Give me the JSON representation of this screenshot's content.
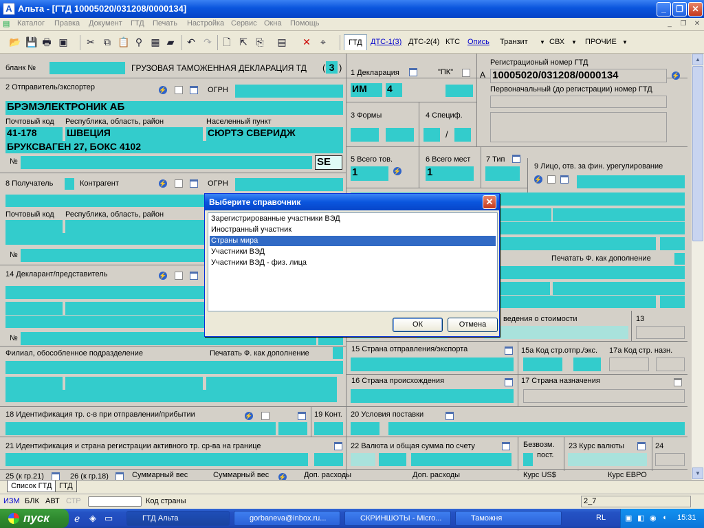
{
  "window": {
    "title": "Альта - [ГТД 10005020/031208/0000134]",
    "app_icon": "A"
  },
  "menu": [
    "Каталог",
    "Правка",
    "Документ",
    "ГТД",
    "Печать",
    "Настройка",
    "Сервис",
    "Окна",
    "Помощь"
  ],
  "doc_tabs": {
    "gtd": "ГТД",
    "dts1": "ДТС-1(3)",
    "dts2": "ДТС-2(4)",
    "kts": "КТС",
    "opis": "Опись",
    "tranzit": "Транзит",
    "svh": "СВХ",
    "prochie": "ПРОЧИЕ"
  },
  "form": {
    "blank_label": "бланк №",
    "doc_title": "ГРУЗОВАЯ ТАМОЖЕННАЯ ДЕКЛАРАЦИЯ  ТД",
    "doc_num": "3",
    "s1_label": "1 Декларация",
    "pk_label": "\"ПК\"",
    "s1_v1": "ИМ",
    "s1_v2": "4",
    "a_label": "А",
    "reg_label": "Регистрационый номер ГТД",
    "reg_num": "10005020/031208/0000134",
    "reg_initial_label": "Первоначальный (до регистрации) номер ГТД",
    "s2_label": "2 Отправитель/экспортер",
    "ogrn": "ОГРН",
    "sender_name": "БРЭМЭЛЕКТРОНИК АБ",
    "postal_label": "Почтовый код",
    "region_label": "Республика, область, район",
    "city_label": "Населенный пункт",
    "postal": "41-178",
    "region": "ШВЕЦИЯ",
    "city": "СЮРТЭ СВЕРИДЖ",
    "street": "БРУКСВАГЕН 27, БОКС 4102",
    "num_label": "№",
    "country_code": "SE",
    "s3_label": "3 Формы",
    "s4_label": "4 Специф.",
    "slash": "/",
    "s5_label": "5 Всего тов.",
    "s5_val": "1",
    "s6_label": "6 Всего мест",
    "s6_val": "1",
    "s7_label": "7 Тип",
    "s8_label": "8 Получатель",
    "kontragent": "Контрагент",
    "s9_label": "9 Лицо, отв. за фин. урегулирование",
    "print_f_addition": "Печатать Ф. как дополнение",
    "s14_label": "14 Декларант/представитель",
    "s12_label": "ведения о стоимости",
    "s13_label": "13",
    "filial_label": "Филиал, обособленное подразделение",
    "s15_label": "15 Страна отправления/экспорта",
    "s15a_label": "15а Код стр.отпр./экс.",
    "s17a_label": "17а Код стр. назн.",
    "s16_label": "16 Страна происхождения",
    "s17_label": "17 Страна назначения",
    "s18_label": "18 Идентификация тр. с-в при отправлении/прибытии",
    "s19_label": "19 Конт.",
    "s20_label": "20 Условия поставки",
    "s21_label": "21 Идентификация и страна регистрации активного тр. ср-ва на границе",
    "s22_label": "22 Валюта и общая сумма по счету",
    "bezvozm_label": "Безвозм.",
    "post_label": "пост.",
    "s23_label": "23 Курс валюты",
    "s24_label": "24",
    "s25_label": "25 (к гр.21)",
    "s26_label": "26 (к гр.18)",
    "total_weight": "Суммарный вес",
    "extra_costs": "Доп. расходы",
    "usd_rate": "Курс US$",
    "eur_rate": "Курс ЕВРО"
  },
  "sheet_tabs": [
    "Список ГТД",
    "ГТД"
  ],
  "status": {
    "izm": "ИЗМ",
    "blk": "БЛК",
    "avt": "АВТ",
    "str": "СТР",
    "hint": "Код страны",
    "pos": "2_7"
  },
  "dialog": {
    "title": "Выберите справочник",
    "items": [
      "Зарегистрированные участники ВЭД",
      "Иностранный участник",
      "Страны мира",
      "Участники ВЭД",
      "Участники ВЭД - физ. лица"
    ],
    "selected_index": 2,
    "ok": "ОК",
    "cancel": "Отмена"
  },
  "taskbar": {
    "start": "пуск",
    "buttons": [
      "ГТД Альта",
      "gorbaneva@inbox.ru...",
      "СКРИНШОТЫ - Micro...",
      "Таможня"
    ],
    "lang": "RL",
    "clock": "15:31"
  }
}
